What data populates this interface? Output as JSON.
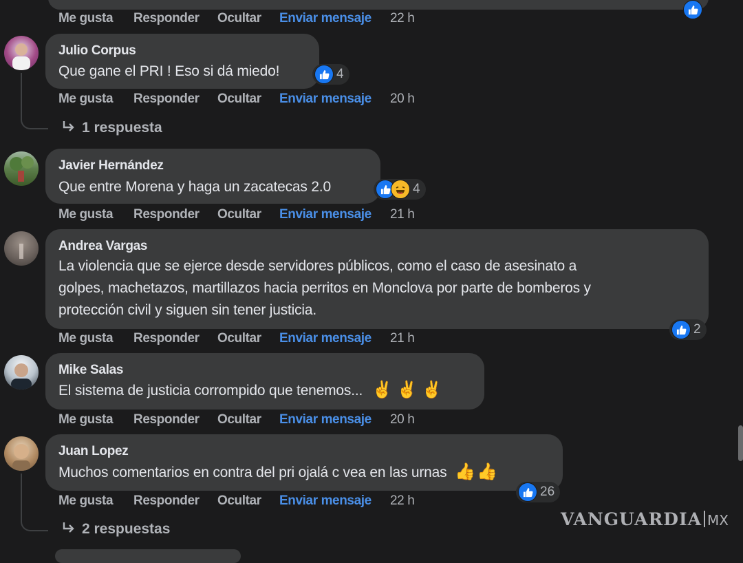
{
  "action_labels": {
    "like": "Me gusta",
    "reply": "Responder",
    "hide": "Ocultar",
    "message": "Enviar mensaje"
  },
  "top_row": {
    "time": "22 h"
  },
  "comments": [
    {
      "author": "Julio Corpus",
      "lines": [
        "Que gane el PRI ! Eso si dá miedo!"
      ],
      "reactions": [
        "like"
      ],
      "reaction_count": "4",
      "time": "20 h",
      "replies_label": "1 respuesta",
      "avatar_icon": "avatar-photo"
    },
    {
      "author": "Javier Hernández",
      "lines": [
        "Que entre Morena y haga un zacatecas 2.0"
      ],
      "reactions": [
        "like",
        "haha"
      ],
      "reaction_count": "4",
      "time": "21 h",
      "avatar_icon": "avatar-photo"
    },
    {
      "author": "Andrea Vargas",
      "lines": [
        "La violencia que se ejerce desde servidores públicos, como el caso de asesinato a",
        "golpes, machetazos, martillazos hacia perritos en Monclova por parte de bomberos y",
        "protección civil y siguen sin tener justicia."
      ],
      "reactions": [
        "like"
      ],
      "reaction_count": "2",
      "time": "21 h",
      "avatar_icon": "avatar-photo"
    },
    {
      "author": "Mike Salas",
      "lines": [
        "El sistema de justicia corrompido que tenemos..."
      ],
      "emoji": "✌️✌️✌️",
      "time": "20 h",
      "avatar_icon": "avatar-photo"
    },
    {
      "author": "Juan Lopez",
      "lines": [
        "Muchos comentarios en contra del pri ojalá c vea en las urnas"
      ],
      "emoji": "👍👍",
      "reactions": [
        "like"
      ],
      "reaction_count": "26",
      "time": "22 h",
      "replies_label": "2 respuestas",
      "avatar_icon": "avatar-photo"
    }
  ],
  "watermark": {
    "brand": "VANGUARDIA",
    "suffix": "MX"
  },
  "colors": {
    "background": "#1b1b1c",
    "bubble": "#3a3b3c",
    "link_blue": "#4a8fe7",
    "like_blue": "#1877f2",
    "muted": "#b0b3b8"
  }
}
